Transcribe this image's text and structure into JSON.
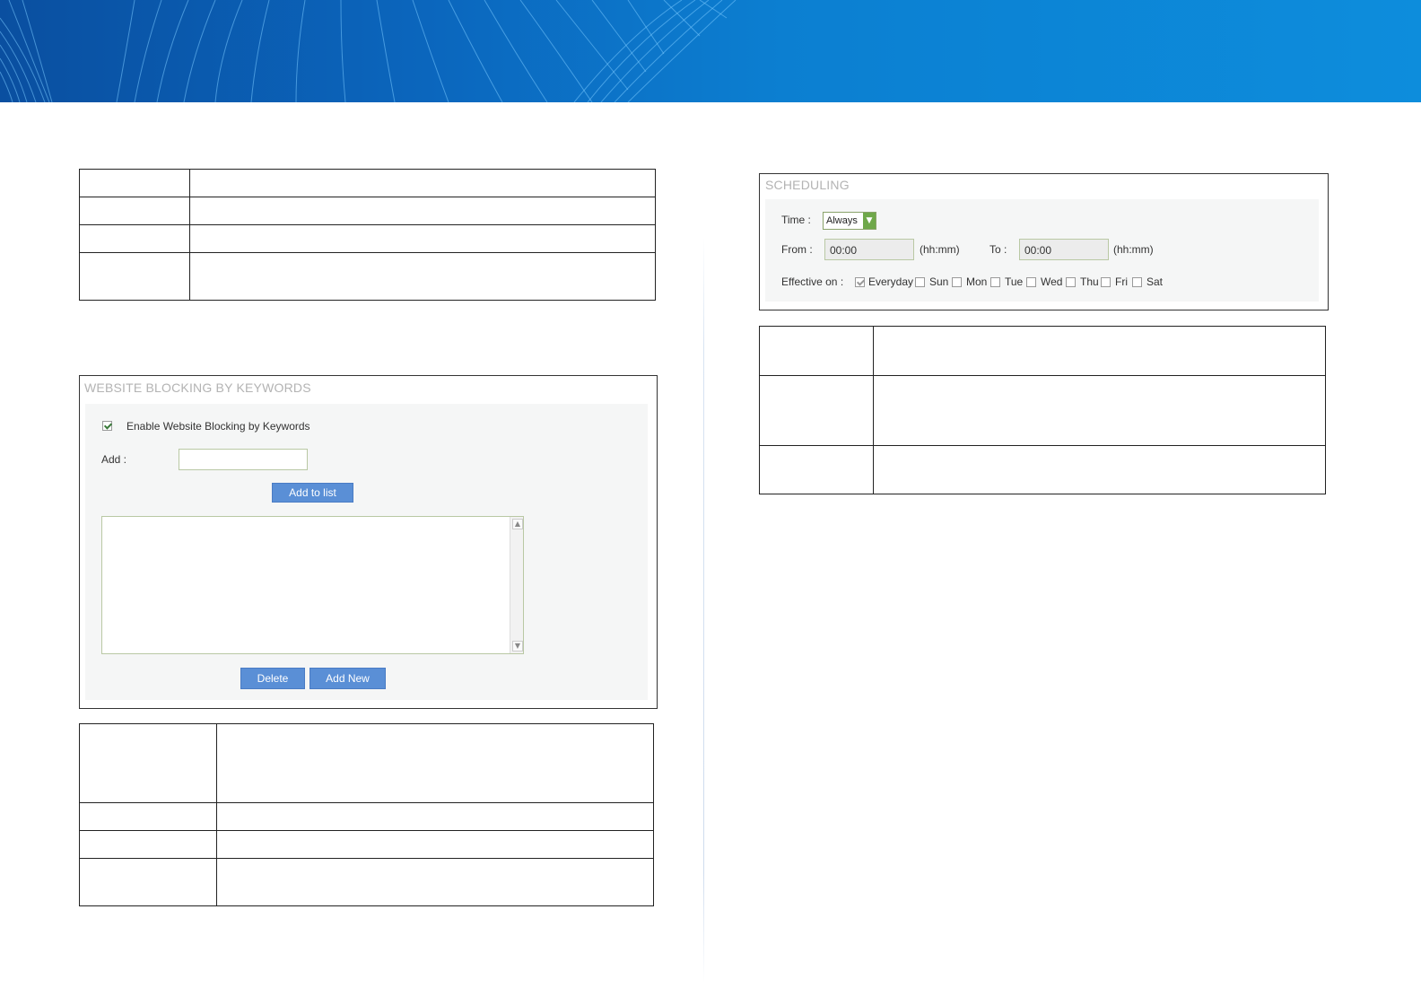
{
  "keyword_panel": {
    "title": "WEBSITE BLOCKING BY KEYWORDS",
    "enable_label": "Enable Website Blocking by Keywords",
    "enable_checked": true,
    "add_label": "Add :",
    "add_value": "",
    "add_to_list_label": "Add to list",
    "keyword_list": [],
    "delete_label": "Delete",
    "add_new_label": "Add New"
  },
  "scheduling_panel": {
    "title": "SCHEDULING",
    "time_label": "Time :",
    "time_value": "Always",
    "from_label": "From :",
    "from_value": "00:00",
    "from_unit": "(hh:mm)",
    "to_label": "To :",
    "to_value": "00:00",
    "to_unit": "(hh:mm)",
    "effective_label": "Effective on :",
    "days": [
      {
        "label": "Everyday",
        "checked": true
      },
      {
        "label": "Sun",
        "checked": false
      },
      {
        "label": "Mon",
        "checked": false
      },
      {
        "label": "Tue",
        "checked": false
      },
      {
        "label": "Wed",
        "checked": false
      },
      {
        "label": "Thu",
        "checked": false
      },
      {
        "label": "Fri",
        "checked": false
      },
      {
        "label": "Sat",
        "checked": false
      }
    ]
  },
  "colors": {
    "banner": "#0b66bd",
    "button": "#5a8fd6",
    "panel_title": "#b3b3b3"
  }
}
